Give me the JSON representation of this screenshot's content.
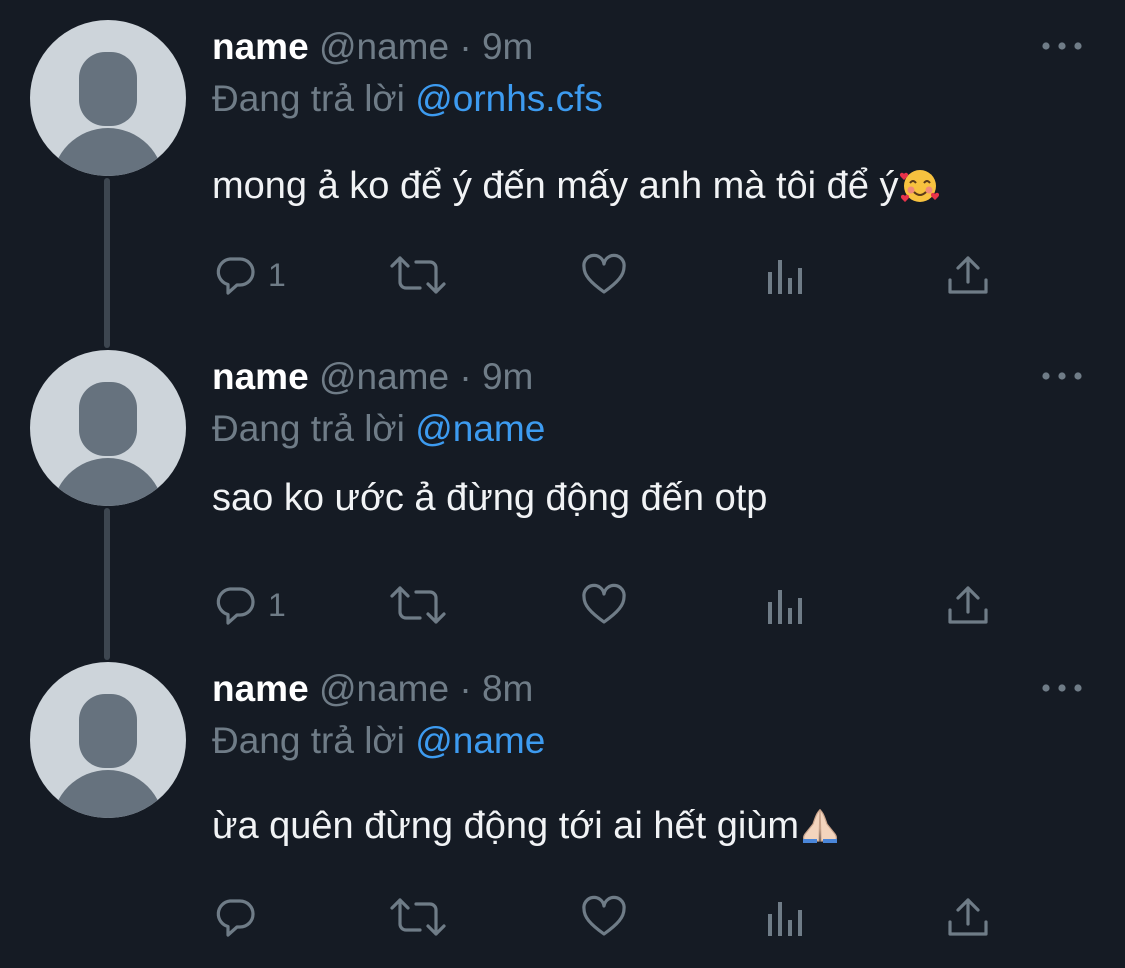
{
  "tweets": [
    {
      "display_name": "name",
      "handle": "@name",
      "separator": "·",
      "time": "9m",
      "replying_prefix": "Đang trả lời",
      "replying_to": "@ornhs.cfs",
      "text": "mong ả ko để ý đến mấy anh mà tôi để ý",
      "emoji": "smiling-face-with-hearts",
      "reply_count": "1"
    },
    {
      "display_name": "name",
      "handle": "@name",
      "separator": "·",
      "time": "9m",
      "replying_prefix": "Đang trả lời",
      "replying_to": "@name",
      "text": "sao ko ước ả đừng động đến otp",
      "emoji": "",
      "reply_count": "1"
    },
    {
      "display_name": "name",
      "handle": "@name",
      "separator": "·",
      "time": "8m",
      "replying_prefix": "Đang trả lời",
      "replying_to": "@name",
      "text": "ừa quên đừng động tới ai hết giùm",
      "emoji": "folded-hands",
      "reply_count": ""
    }
  ],
  "icons": {
    "reply": "reply-icon",
    "retweet": "retweet-icon",
    "like": "heart-icon",
    "analytics": "analytics-icon",
    "share": "share-icon",
    "more": "more-options-icon"
  },
  "colors": {
    "background": "#151b24",
    "name": "#ffffff",
    "muted": "#6f7c87",
    "mention": "#3d9bf0",
    "thread_line": "#3d4650"
  }
}
